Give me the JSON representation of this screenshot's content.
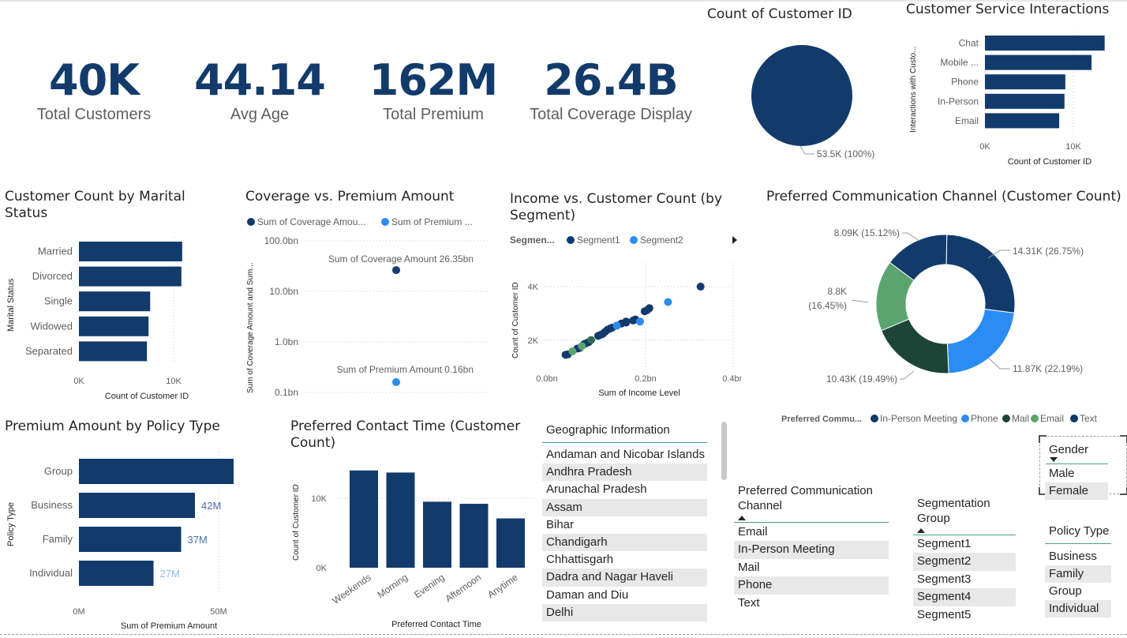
{
  "kpis": [
    {
      "value": "40K",
      "label": "Total Customers"
    },
    {
      "value": "44.14",
      "label": "Avg Age"
    },
    {
      "value": "162M",
      "label": "Total Premium"
    },
    {
      "value": "26.4B",
      "label": "Total Coverage Display"
    }
  ],
  "pie_count": {
    "title": "Count of Customer ID",
    "label": "53.5K (100%)",
    "color": "#123b6b"
  },
  "service_interactions": {
    "title": "Customer Service Interactions",
    "ylabel": "Interactions with Custo...",
    "xlabel": "Count of Customer ID",
    "ticks": [
      "0K",
      "10K"
    ]
  },
  "marital": {
    "title_line1": "Customer Count by Marital",
    "title_line2": "Status",
    "ylabel": "Marital Status",
    "xlabel": "Count of Customer ID",
    "ticks": [
      "0K",
      "10K"
    ]
  },
  "coverage_premium": {
    "title": "Coverage vs. Premium Amount",
    "legend": [
      "Sum of Coverage Amou...",
      "Sum of Premium ..."
    ],
    "ylabel": "Sum of Coverage Amount and Sum...",
    "yticks": [
      "100.0bn",
      "10.0bn",
      "1.0bn",
      "0.1bn"
    ],
    "label_coverage": "Sum of Coverage Amount 26.35bn",
    "label_premium": "Sum of Premium Amount 0.16bn"
  },
  "income_segment": {
    "title_line1": "Income vs. Customer Count (by",
    "title_line2": "Segment)",
    "legend_title": "Segmen...",
    "legend": [
      "Segment1",
      "Segment2"
    ],
    "ylabel": "Count of Customer ID",
    "xlabel": "Sum of Income Level",
    "xticks": [
      "0.0bn",
      "0.2bn",
      "0.4bn"
    ],
    "yticks": [
      "4K",
      "2K"
    ]
  },
  "comm_channel": {
    "title": "Preferred Communication Channel (Customer Count)",
    "legend_title": "Preferred Commu...",
    "legend": [
      "In-Person Meeting",
      "Phone",
      "Mail",
      "Email",
      "Text"
    ],
    "labels": [
      "14.31K (26.75%)",
      "11.87K (22.19%)",
      "10.43K (19.49%)",
      "8.8K",
      "(16.45%)",
      "8.09K (15.12%)"
    ]
  },
  "policy_premium": {
    "title": "Premium Amount by Policy Type",
    "ylabel": "Policy Type",
    "xlabel": "Sum of Premium Amount",
    "ticks": [
      "0M",
      "50M"
    ],
    "value_labels": [
      "56M",
      "42M",
      "37M",
      "27M"
    ]
  },
  "contact_time": {
    "title_line1": "Preferred Contact Time (Customer",
    "title_line2": "Count)",
    "ylabel": "Count of Customer ID",
    "xlabel": "Preferred Contact Time",
    "yticks": [
      "10K",
      "0K"
    ]
  },
  "geo_slicer": {
    "title": "Geographic Information",
    "items": [
      "Andaman and Nicobar Islands",
      "Andhra Pradesh",
      "Arunachal Pradesh",
      "Assam",
      "Bihar",
      "Chandigarh",
      "Chhattisgarh",
      "Dadra and Nagar Haveli",
      "Daman and Diu",
      "Delhi"
    ]
  },
  "comm_slicer": {
    "title_line1": "Preferred Communication",
    "title_line2": "Channel",
    "items": [
      "Email",
      "In-Person Meeting",
      "Mail",
      "Phone",
      "Text"
    ]
  },
  "segment_slicer": {
    "title_line1": "Segmentation",
    "title_line2": "Group",
    "items": [
      "Segment1",
      "Segment2",
      "Segment3",
      "Segment4",
      "Segment5"
    ]
  },
  "gender_slicer": {
    "title": "Gender",
    "items": [
      "Male",
      "Female"
    ]
  },
  "policy_slicer": {
    "title": "Policy Type",
    "items": [
      "Business",
      "Family",
      "Group",
      "Individual"
    ]
  },
  "chart_data": [
    {
      "type": "pie",
      "title": "Count of Customer ID",
      "categories": [
        ""
      ],
      "values": [
        53500
      ]
    },
    {
      "type": "bar",
      "orientation": "horizontal",
      "title": "Customer Service Interactions",
      "categories": [
        "Chat",
        "Mobile ...",
        "Phone",
        "In-Person",
        "Email"
      ],
      "values": [
        13700,
        12200,
        9200,
        9100,
        8500
      ],
      "xlabel": "Count of Customer ID",
      "ylabel": "Interactions with Custo...",
      "xlim": [
        0,
        14000
      ]
    },
    {
      "type": "bar",
      "orientation": "horizontal",
      "title": "Customer Count by Marital Status",
      "categories": [
        "Married",
        "Divorced",
        "Single",
        "Widowed",
        "Separated"
      ],
      "values": [
        12900,
        12800,
        8900,
        8700,
        8500
      ],
      "xlabel": "Count of Customer ID",
      "ylabel": "Marital Status",
      "xlim": [
        0,
        14000
      ]
    },
    {
      "type": "scatter",
      "title": "Coverage vs. Premium Amount",
      "log_y": true,
      "ylim": [
        0.1,
        100
      ],
      "series": [
        {
          "name": "Sum of Coverage Amou...",
          "color": "#123b6b",
          "points": [
            {
              "y": 26.35
            }
          ]
        },
        {
          "name": "Sum of Premium ...",
          "color": "#2b8cf4",
          "points": [
            {
              "y": 0.16
            }
          ]
        }
      ]
    },
    {
      "type": "scatter",
      "title": "Income vs. Customer Count (by Segment)",
      "xlabel": "Sum of Income Level",
      "ylabel": "Count of Customer ID",
      "xlim": [
        0,
        0.4
      ],
      "ylim": [
        0,
        4600
      ],
      "series": [
        {
          "name": "Segment1",
          "color": "#123b6b",
          "points": [
            [
              0.33,
              4000
            ],
            [
              0.19,
              2400
            ],
            [
              0.185,
              2350
            ],
            [
              0.16,
              2200
            ],
            [
              0.17,
              2250
            ],
            [
              0.14,
              2000
            ],
            [
              0.13,
              1900
            ],
            [
              0.12,
              1700
            ],
            [
              0.125,
              1800
            ],
            [
              0.11,
              1600
            ],
            [
              0.09,
              1300
            ],
            [
              0.085,
              1250
            ],
            [
              0.08,
              1200
            ],
            [
              0.07,
              1000
            ],
            [
              0.065,
              980
            ],
            [
              0.045,
              700
            ],
            [
              0.04,
              680
            ],
            [
              0.21,
              2800
            ],
            [
              0.215,
              2850
            ],
            [
              0.22,
              2950
            ],
            [
              0.135,
              1950
            ],
            [
              0.115,
              1650
            ],
            [
              0.095,
              1400
            ],
            [
              0.17,
              2300
            ],
            [
              0.15,
              2100
            ]
          ]
        },
        {
          "name": "Segment2",
          "color": "#2b8cf4",
          "points": [
            [
              0.26,
              3250
            ],
            [
              0.2,
              2300
            ],
            [
              0.075,
              1100
            ],
            [
              0.15,
              2100
            ],
            [
              0.055,
              850
            ]
          ]
        }
      ]
    },
    {
      "type": "pie",
      "subtype": "donut",
      "title": "Preferred Communication Channel (Customer Count)",
      "categories": [
        "In-Person Meeting",
        "Phone",
        "Mail",
        "Email",
        "Text"
      ],
      "values": [
        14310,
        11870,
        10430,
        8800,
        8090
      ],
      "percent": [
        26.75,
        22.19,
        19.49,
        16.45,
        15.12
      ],
      "colors": [
        "#123b6b",
        "#2b8cf4",
        "#1c4538",
        "#5aa56f",
        "#123b6b"
      ]
    },
    {
      "type": "bar",
      "orientation": "horizontal",
      "title": "Premium Amount by Policy Type",
      "categories": [
        "Group",
        "Business",
        "Family",
        "Individual"
      ],
      "values": [
        56,
        42,
        37,
        27
      ],
      "xlabel": "Sum of Premium Amount",
      "ylabel": "Policy Type",
      "xlim": [
        0,
        56
      ]
    },
    {
      "type": "bar",
      "title": "Preferred Contact Time (Customer Count)",
      "categories": [
        "Weekends",
        "Morning",
        "Evening",
        "Afternoon",
        "Anytime"
      ],
      "values": [
        14000,
        13700,
        9500,
        9200,
        7100
      ],
      "xlabel": "Preferred Contact Time",
      "ylabel": "Count of Customer ID",
      "ylim": [
        0,
        15000
      ]
    }
  ]
}
